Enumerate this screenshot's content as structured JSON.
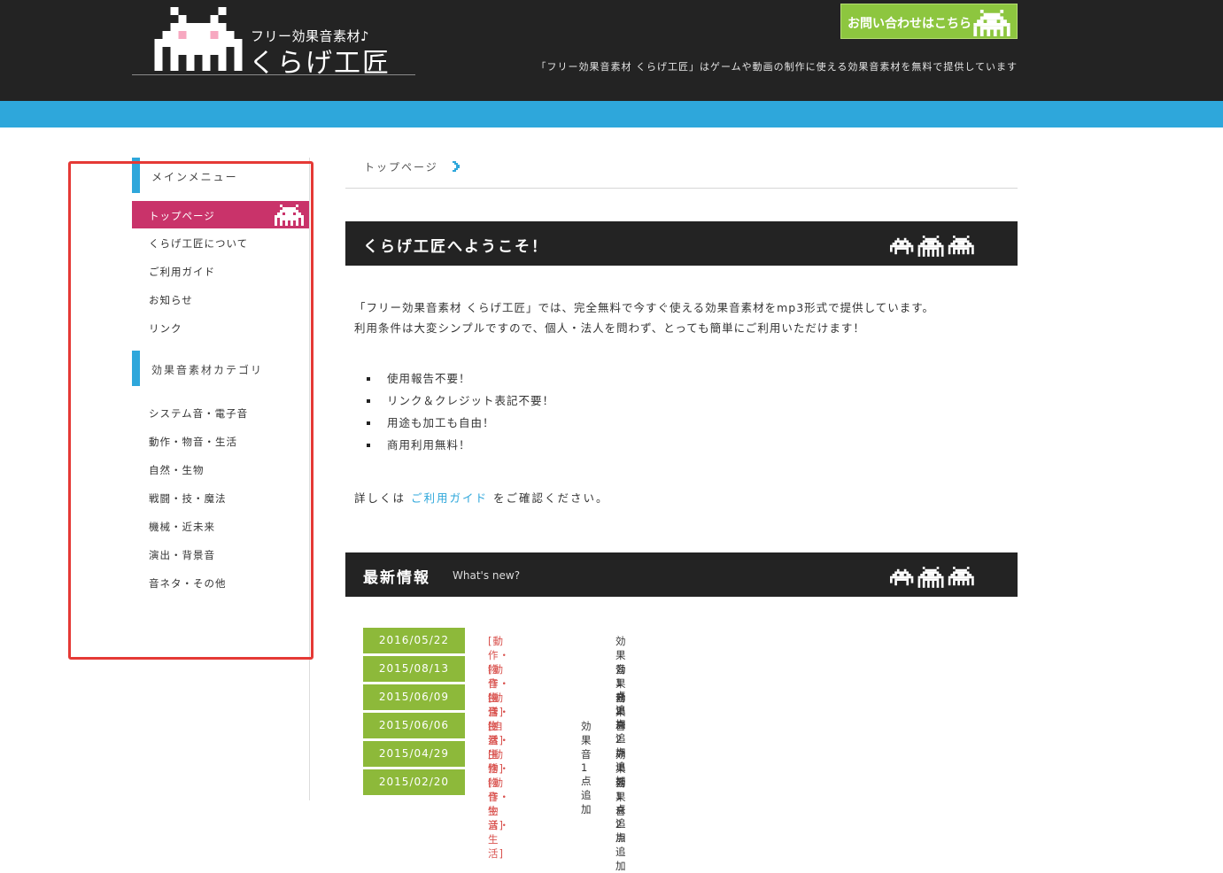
{
  "header": {
    "logo_sub": "フリー効果音素材♪",
    "logo_main": "くらげ工匠",
    "contact_button": "お問い合わせはこちら",
    "tagline": "「フリー効果音素材 くらげ工匠」はゲームや動画の制作に使える効果音素材を無料で提供しています"
  },
  "sidebar": {
    "main_menu_title": "メインメニュー",
    "main_menu": [
      {
        "label": "トップページ",
        "active": true
      },
      {
        "label": "くらげ工匠について"
      },
      {
        "label": "ご利用ガイド"
      },
      {
        "label": "お知らせ"
      },
      {
        "label": "リンク"
      }
    ],
    "category_title": "効果音素材カテゴリ",
    "categories": [
      {
        "label": "システム音・電子音"
      },
      {
        "label": "動作・物音・生活"
      },
      {
        "label": "自然・生物"
      },
      {
        "label": "戦闘・技・魔法"
      },
      {
        "label": "機械・近未来"
      },
      {
        "label": "演出・背景音"
      },
      {
        "label": "音ネタ・その他"
      }
    ]
  },
  "breadcrumb": "トップページ",
  "welcome": {
    "title": "くらげ工匠へようこそ！",
    "intro_line1": "「フリー効果音素材 くらげ工匠」では、完全無料で今すぐ使える効果音素材をmp3形式で提供しています。",
    "intro_line2": "利用条件は大変シンプルですので、個人・法人を問わず、とっても簡単にご利用いただけます！",
    "bullets": [
      "使用報告不要！",
      "リンク＆クレジット表記不要！",
      "用途も加工も自由！",
      "商用利用無料！"
    ],
    "details_prefix": "詳しくは",
    "details_link": "ご利用ガイド",
    "details_suffix": "をご確認ください。"
  },
  "news": {
    "title": "最新情報",
    "subtitle": "What's new?",
    "items": [
      {
        "date": "2016/05/22",
        "category": "[動作・物音・生活]",
        "text": "効果音1点追加"
      },
      {
        "date": "2015/08/13",
        "category": "[動作・物音・生活]",
        "text": "効果音2点追加"
      },
      {
        "date": "2015/06/09",
        "category": "[動作・物音・生活]",
        "text": "効果音2点追加"
      },
      {
        "date": "2015/06/06",
        "category": "[自然・生物]",
        "text": "効果音1点追加"
      },
      {
        "date": "2015/04/29",
        "category": "[動作・物音・生活]",
        "text": "効果音1点追加"
      },
      {
        "date": "2015/02/20",
        "category": "[動作・物音・生活]",
        "text": "効果音2点追加"
      }
    ]
  },
  "colors": {
    "header_bg": "#232323",
    "accent_blue": "#2ea7db",
    "active_pink": "#c9336a",
    "contact_green": "#8dc63f",
    "date_green": "#8db93a",
    "category_red": "#d9534f",
    "highlight_box": "#e53935"
  },
  "icons": [
    "invader-logo-icon",
    "invader-icon",
    "chevron-right-icon"
  ]
}
